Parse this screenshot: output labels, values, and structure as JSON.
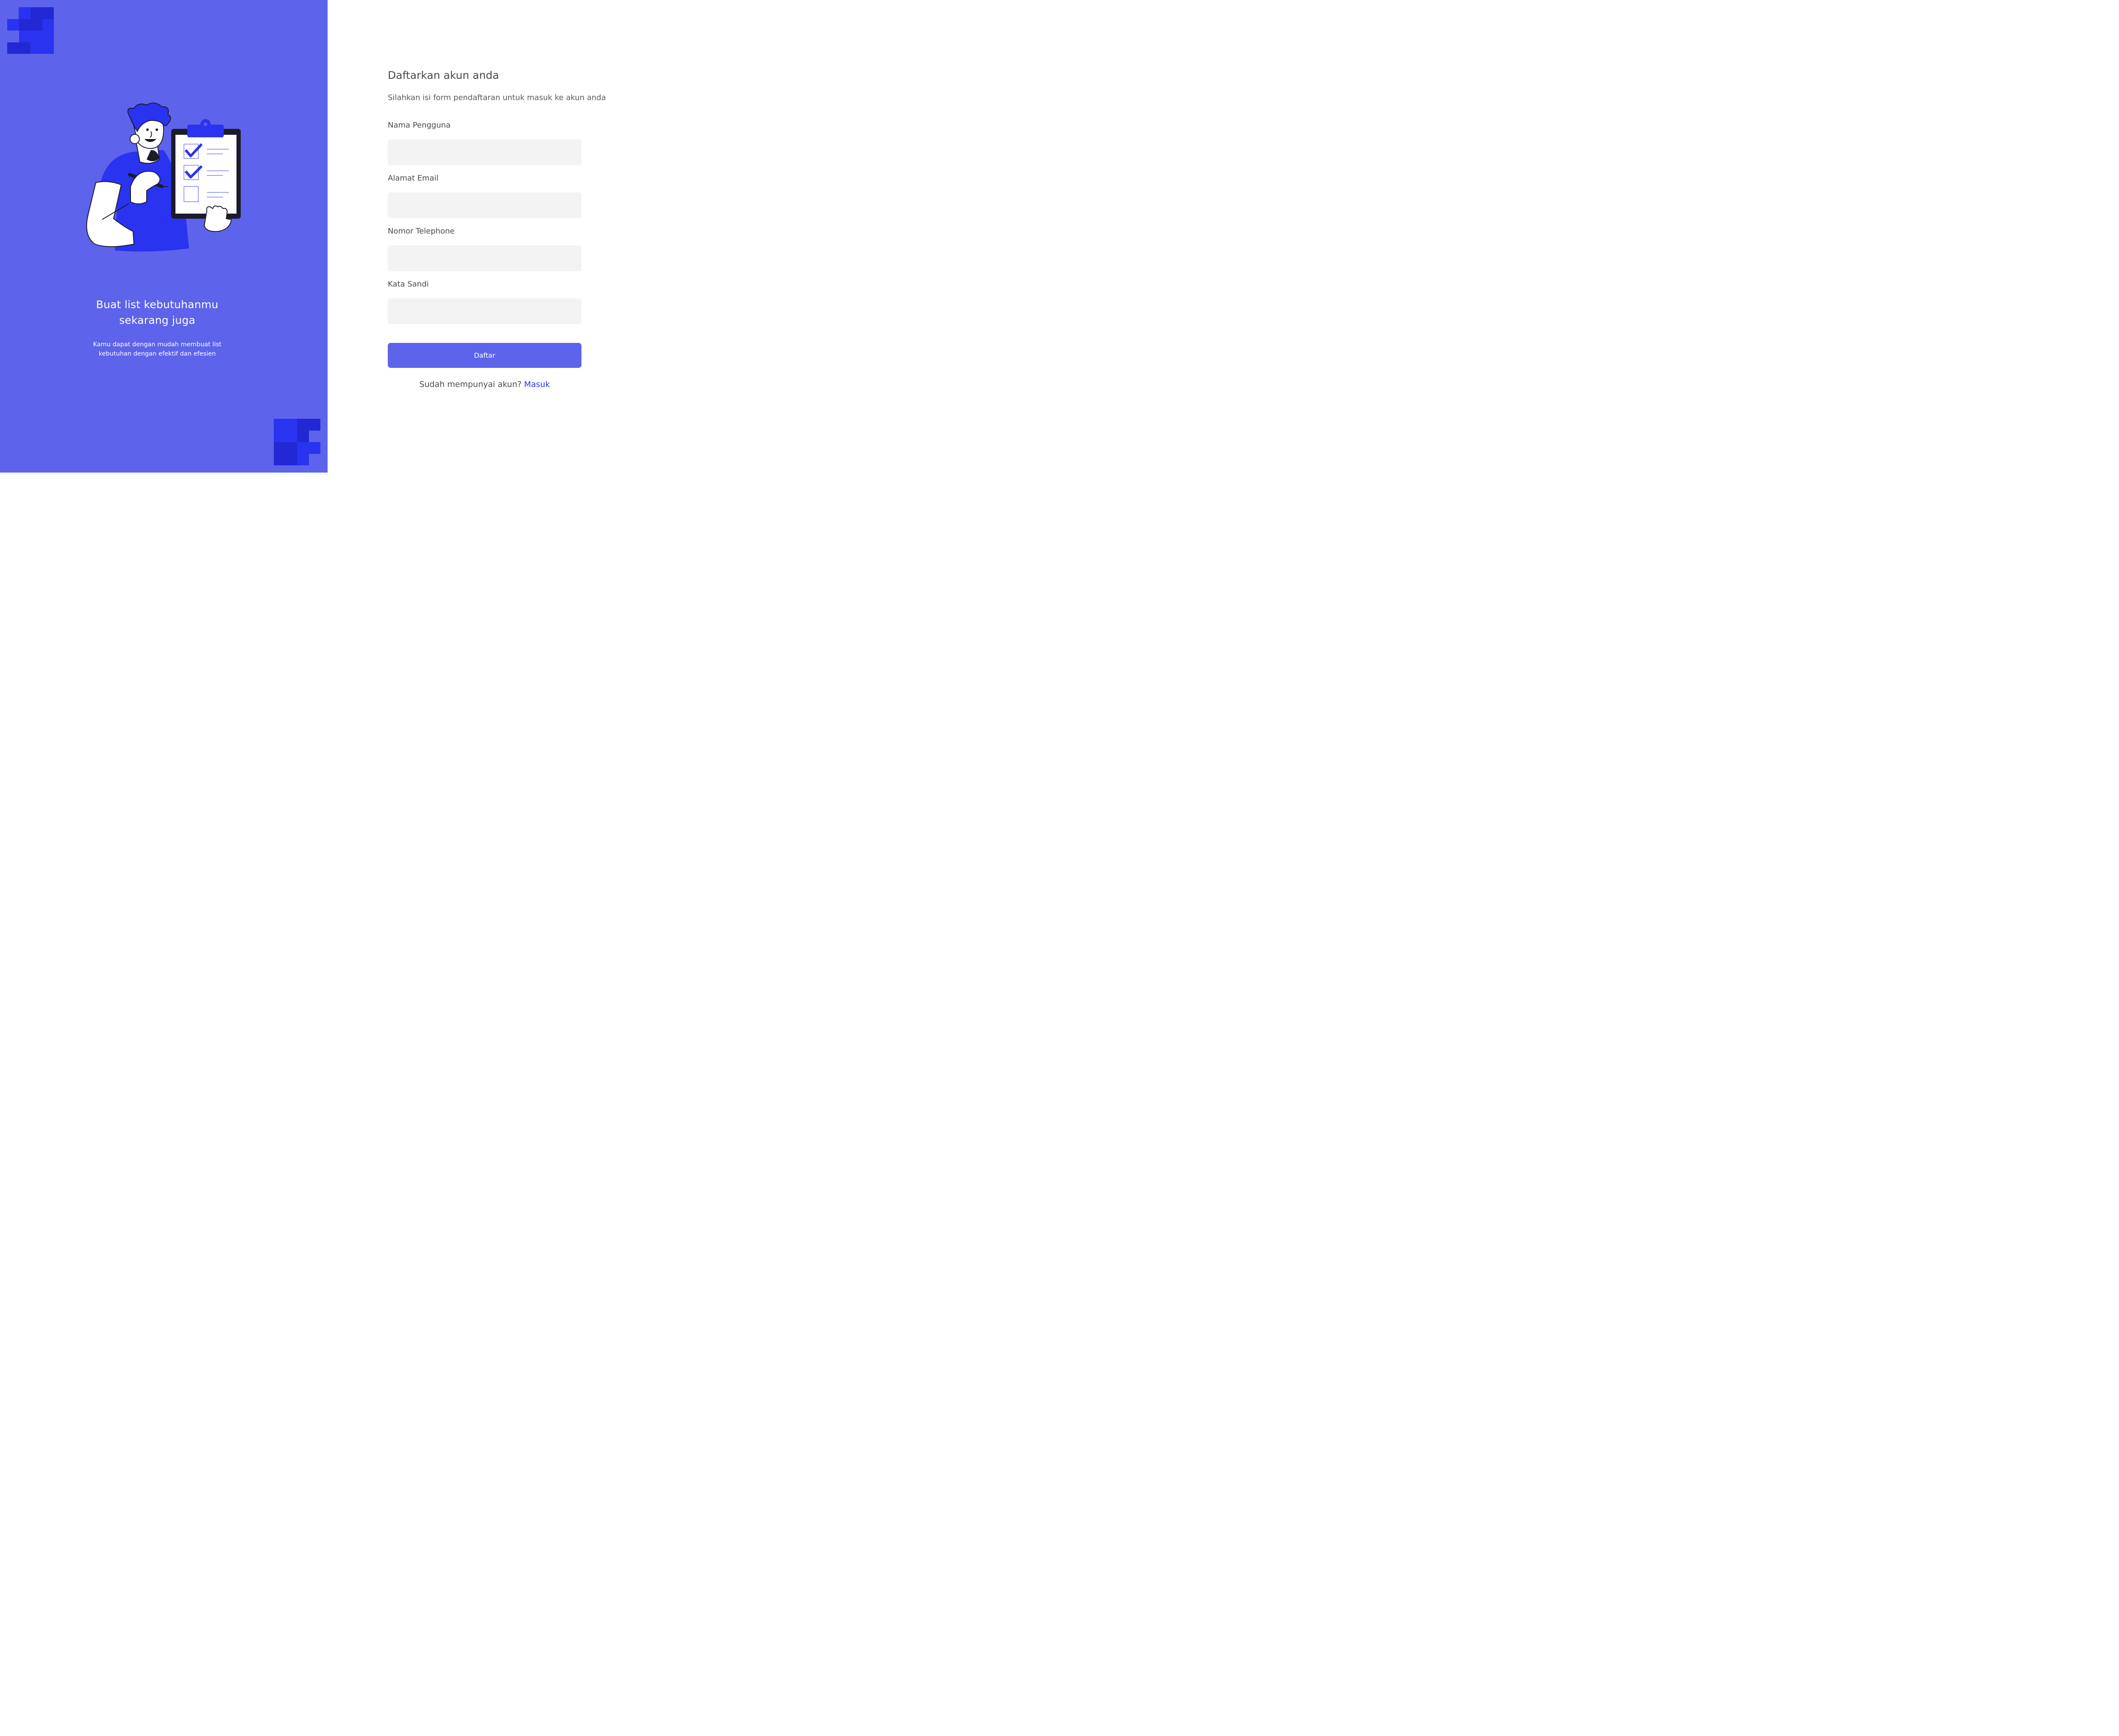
{
  "hero": {
    "title_line1": "Buat list kebutuhanmu",
    "title_line2": "sekarang juga",
    "desc_line1": "Kamu dapat dengan mudah membuat list",
    "desc_line2": "kebutuhan dengan efektif dan efesien"
  },
  "form": {
    "title": "Daftarkan akun anda",
    "subtitle": "Silahkan isi form pendaftaran untuk masuk ke akun anda",
    "fields": [
      {
        "label": "Nama Pengguna",
        "value": ""
      },
      {
        "label": "Alamat Email",
        "value": ""
      },
      {
        "label": "Nomor Telephone",
        "value": ""
      },
      {
        "label": "Kata Sandi",
        "value": ""
      }
    ],
    "submit_label": "Daftar",
    "signin_prompt": "Sudah mempunyai akun?",
    "signin_link": "Masuk"
  },
  "colors": {
    "panel_bg": "#5E63EC",
    "accent": "#2A33F0",
    "logo_dark": "#2228D4",
    "input_bg": "#F3F3F3"
  },
  "icons": {
    "logo": "brand-blocks-logo",
    "illustration": "man-with-checklist-illustration",
    "check": "checkmark-icon"
  }
}
